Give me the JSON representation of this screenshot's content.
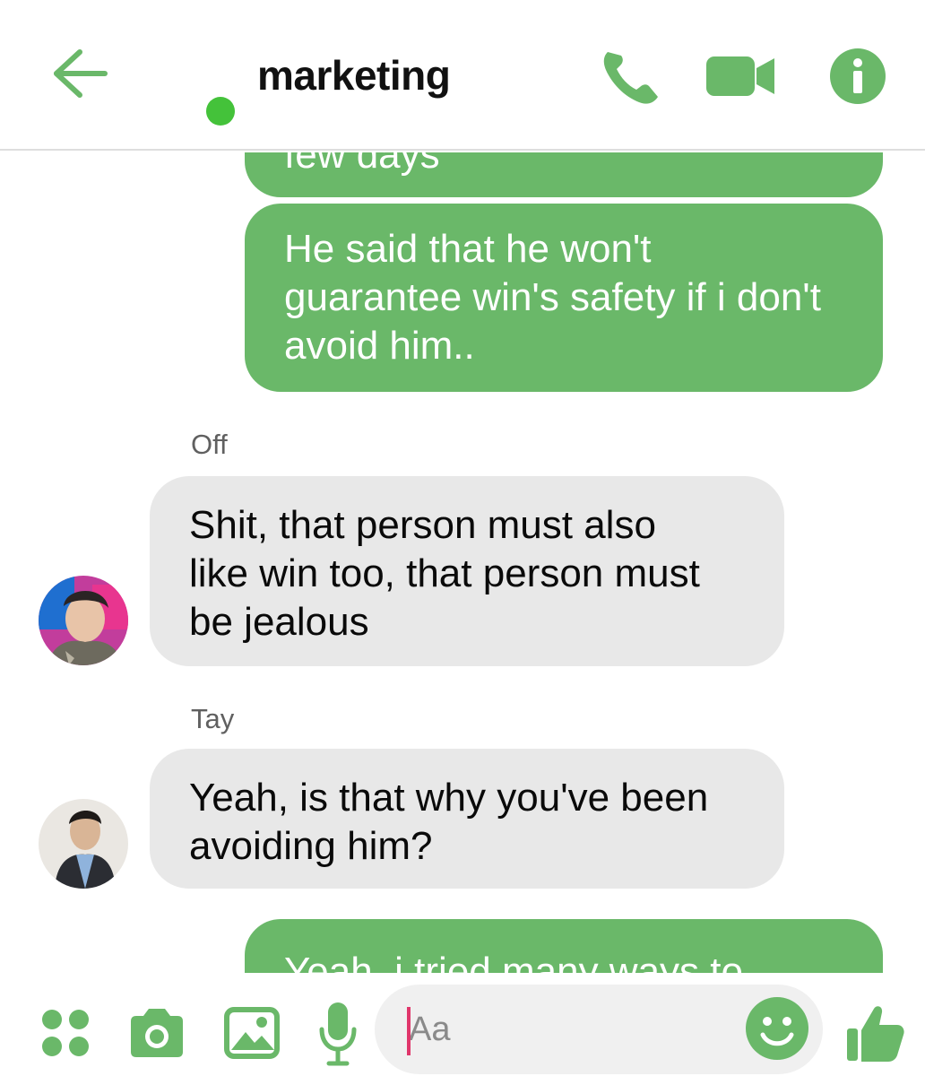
{
  "header": {
    "title": "marketing",
    "accent_color": "#6ab869",
    "online_color": "#44c23a",
    "icons": [
      "arrow-left-icon",
      "phone-icon",
      "video-camera-icon",
      "info-icon"
    ]
  },
  "messages": [
    {
      "type": "outgoing",
      "lines": [
        "few days"
      ]
    },
    {
      "type": "outgoing",
      "lines": [
        "He said that he won't",
        "guarantee win's safety if i don't",
        "avoid him.."
      ]
    },
    {
      "sender": "Off",
      "type": "incoming",
      "lines": [
        "Shit, that person must also",
        "like win too, that person must",
        "be jealous"
      ]
    },
    {
      "sender": "Tay",
      "type": "incoming",
      "lines": [
        "Yeah, is that why you've been",
        "avoiding him?"
      ]
    },
    {
      "type": "outgoing",
      "lines": [
        "Yeah, i tried many ways to"
      ]
    }
  ],
  "composer": {
    "placeholder": "Aa",
    "icons": [
      "apps-grid-icon",
      "camera-icon",
      "gallery-icon",
      "microphone-icon",
      "emoji-icon",
      "thumbs-up-icon"
    ]
  }
}
